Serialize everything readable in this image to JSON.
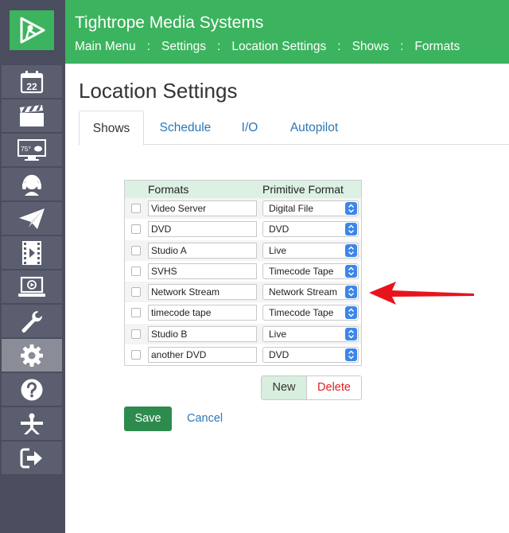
{
  "app": {
    "title": "Tightrope Media Systems"
  },
  "breadcrumb": [
    {
      "label": "Main Menu"
    },
    {
      "label": "Settings"
    },
    {
      "label": "Location Settings"
    },
    {
      "label": "Shows"
    },
    {
      "label": "Formats"
    }
  ],
  "breadcrumb_separator": ":",
  "sidebar": {
    "logo_icon": "play-triangle-logo",
    "items": [
      {
        "icon": "calendar-icon",
        "text": "22",
        "active": false
      },
      {
        "icon": "clapperboard-icon",
        "active": false
      },
      {
        "icon": "monitor-weather-icon",
        "text": "75°",
        "active": false
      },
      {
        "icon": "headset-icon",
        "active": false
      },
      {
        "icon": "paper-plane-icon",
        "active": false
      },
      {
        "icon": "film-icon",
        "active": false
      },
      {
        "icon": "laptop-play-icon",
        "active": false
      },
      {
        "icon": "wrench-icon",
        "active": false
      },
      {
        "icon": "gear-icon",
        "active": true
      },
      {
        "icon": "help-icon",
        "active": false
      },
      {
        "icon": "network-icon",
        "active": false
      },
      {
        "icon": "logout-icon",
        "active": false
      }
    ]
  },
  "page": {
    "title": "Location Settings"
  },
  "tabs": [
    {
      "label": "Shows",
      "active": true
    },
    {
      "label": "Schedule",
      "active": false
    },
    {
      "label": "I/O",
      "active": false
    },
    {
      "label": "Autopilot",
      "active": false
    }
  ],
  "table": {
    "headers": {
      "formats": "Formats",
      "primitive": "Primitive Format"
    },
    "rows": [
      {
        "format": "Video Server",
        "primitive": "Digital File",
        "checked": false
      },
      {
        "format": "DVD",
        "primitive": "DVD",
        "checked": false
      },
      {
        "format": "Studio A",
        "primitive": "Live",
        "checked": false
      },
      {
        "format": "SVHS",
        "primitive": "Timecode Tape",
        "checked": false
      },
      {
        "format": "Network Stream",
        "primitive": "Network Stream",
        "checked": false
      },
      {
        "format": "timecode tape",
        "primitive": "Timecode Tape",
        "checked": false
      },
      {
        "format": "Studio B",
        "primitive": "Live",
        "checked": false
      },
      {
        "format": "another DVD",
        "primitive": "DVD",
        "checked": false
      }
    ]
  },
  "buttons": {
    "new": "New",
    "delete": "Delete",
    "save": "Save",
    "cancel": "Cancel"
  },
  "colors": {
    "header_green": "#3cb35e",
    "sidebar_bg": "#4a4d5d",
    "link_blue": "#2a77b7",
    "save_green": "#2e8b4e",
    "delete_red": "#e02020",
    "annotation_red": "#e8141c"
  }
}
